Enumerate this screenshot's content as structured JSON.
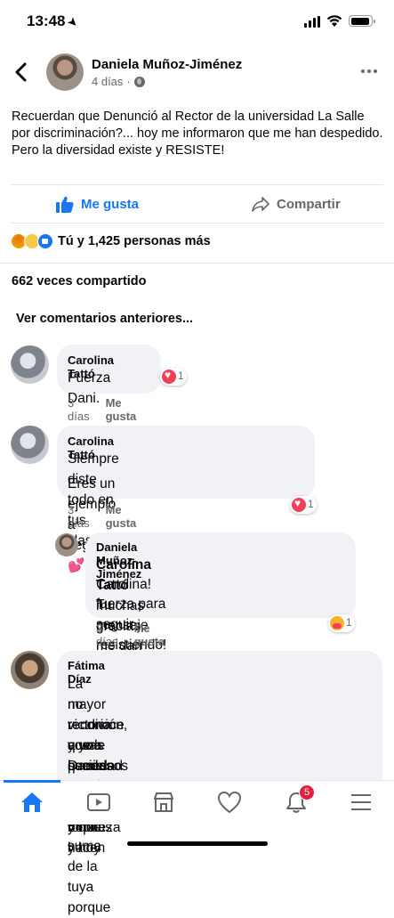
{
  "status": {
    "time": "13:48"
  },
  "post": {
    "author": "Daniela Muñoz-Jiménez",
    "age": "4 días",
    "text": "Recuerdan que Denunció al Rector de la universidad La Salle por discriminación?... hoy me informaron que me han despedido.\nPero la diversidad existe y RESISTE!"
  },
  "actions": {
    "like": "Me gusta",
    "share": "Compartir"
  },
  "reactions": {
    "summary": "Tú y 1,425 personas más"
  },
  "shares": "662 veces compartido",
  "more_comments": "Ver comentarios anteriores...",
  "comments": [
    {
      "name": "Carolina Tattó",
      "text": "Fuerza Dani.",
      "time": "3 días",
      "like": "Me gusta",
      "reaction_count": "1"
    },
    {
      "name": "Carolina Tattó",
      "line1": "Siempre diste todo en tus clases!!!",
      "line2": "Eres un ejemplo a seguir 💕",
      "time": "3 días",
      "like": "Me gusta",
      "reaction_count": "1"
    },
    {
      "name": "Daniela Muñoz-Jiménez",
      "mention": "Carolina Tattó",
      "line1_rest": " muchas gracias,",
      "line2": "Carolina! Tu mensaje me dan mucha",
      "line3": "fuerza para seguir resistiendo!",
      "time": "3 días",
      "like": "Me gusta",
      "reaction_count": "1"
    },
    {
      "name": "Fátima Díaz",
      "lines": [
        "La mayor victoria que le puedas dar a quien",
        "no reconoce a una sociedad diversa es la",
        "rendición, y yo Daniela aparte de las bonitas",
        "cosas que has logrado y que hacen",
        "hermosos los días, es tu fortaleza y hoy",
        "nuestra fuerza es la suma de la tuya porque"
      ]
    }
  ],
  "tabbar": {
    "notifications_badge": "5"
  },
  "icons": [
    "location-arrow-icon",
    "signal-icon",
    "wifi-icon",
    "battery-icon",
    "back-icon",
    "globe-icon",
    "more-icon",
    "like-icon",
    "share-icon",
    "home-icon",
    "watch-icon",
    "marketplace-icon",
    "dating-icon",
    "bell-icon",
    "menu-icon"
  ],
  "colors": {
    "accent": "#1877f2",
    "secondary_text": "#65676b",
    "bubble": "#f0f2f5",
    "badge": "#e41e3f"
  }
}
